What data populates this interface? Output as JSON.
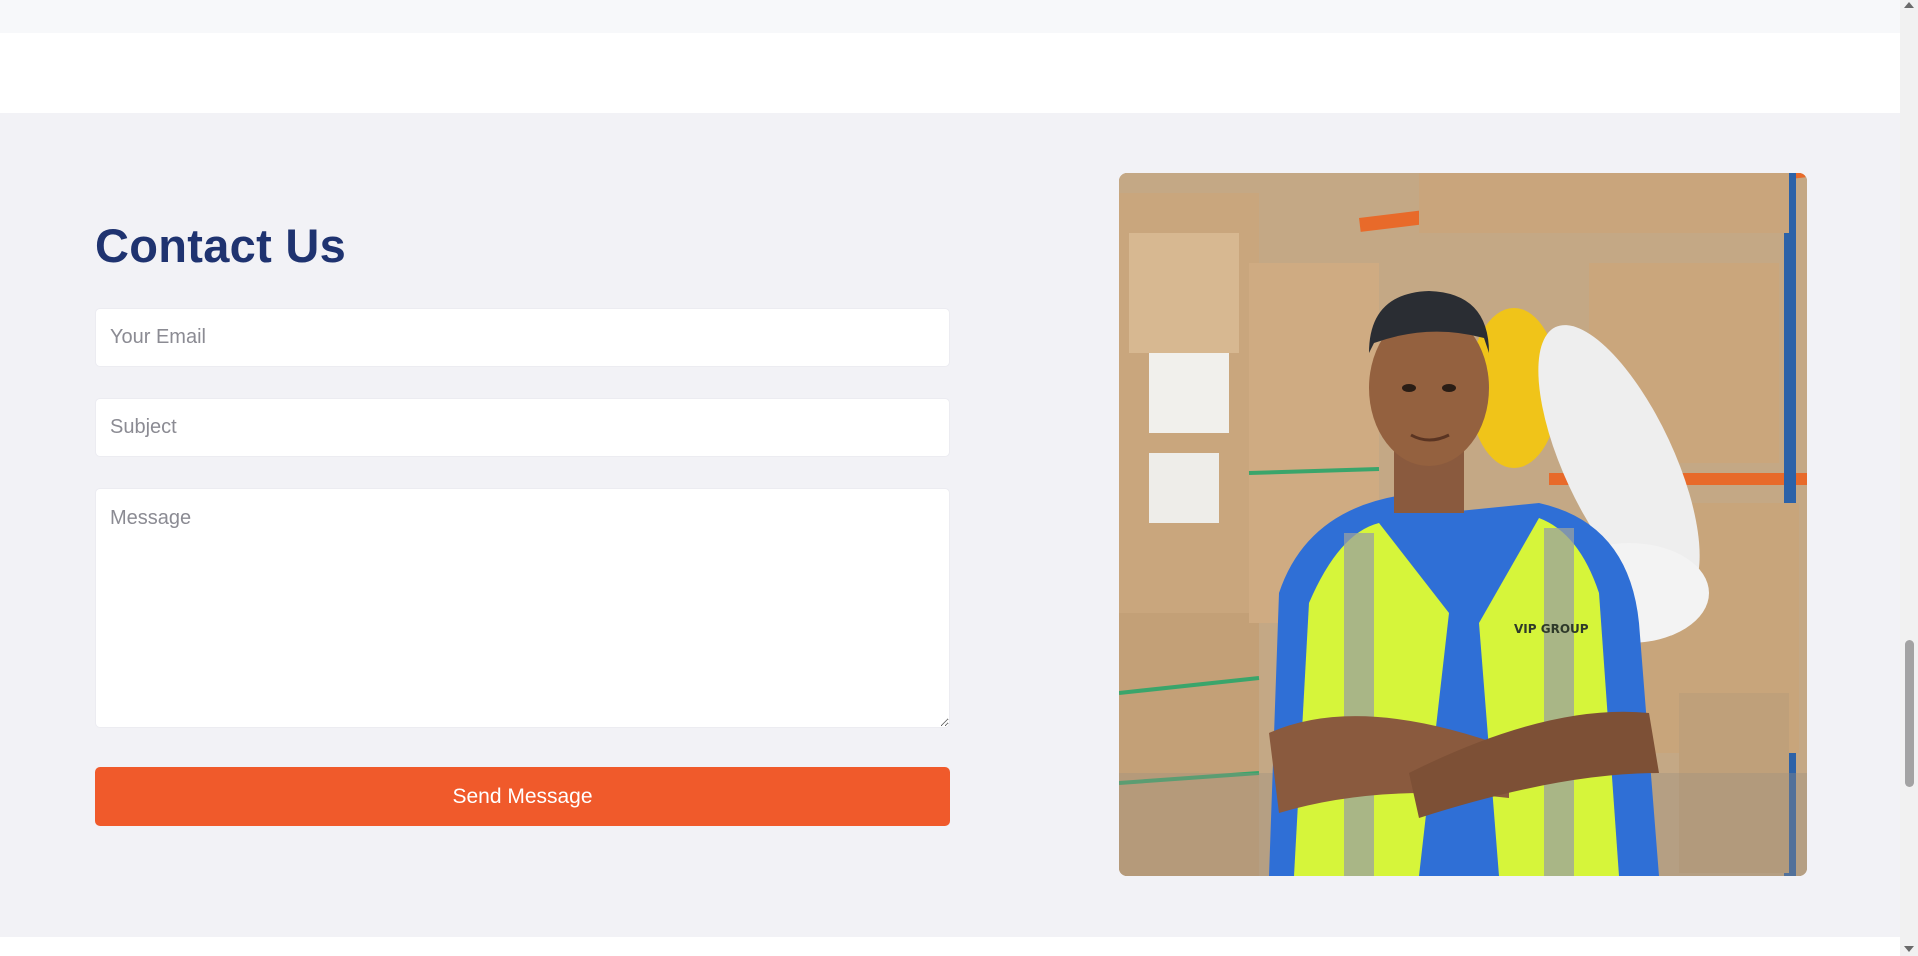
{
  "contact": {
    "title": "Contact Us",
    "email_placeholder": "Your Email",
    "subject_placeholder": "Subject",
    "message_placeholder": "Message",
    "send_label": "Send Message"
  },
  "photo": {
    "vest_logo_text": "VIP GROUP"
  },
  "colors": {
    "title": "#1f3370",
    "button": "#f05a2b",
    "section_background": "#f2f2f6"
  },
  "icons": {
    "resize_handle": "resize-handle-icon",
    "scroll_up": "scroll-up-arrow-icon",
    "scroll_down": "scroll-down-arrow-icon"
  }
}
